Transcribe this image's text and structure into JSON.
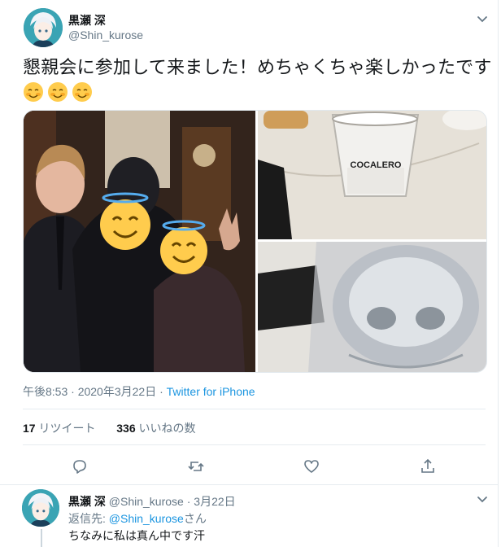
{
  "tweet": {
    "display_name": "黒瀬 深",
    "handle": "@Shin_kurose",
    "text": "懇親会に参加して来ました！めちゃくちゃ楽しかったです",
    "emojis": "☺☺☺",
    "timestamp": "午後8:53 · 2020年3月22日 · ",
    "source": "Twitter for iPhone",
    "retweets_count": "17",
    "retweets_label": "リツイート",
    "likes_count": "336",
    "likes_label": "いいねの数"
  },
  "media": {
    "glass_label": "COCALERO"
  },
  "actions": {
    "reply_icon": "reply-icon",
    "retweet_icon": "retweet-icon",
    "like_icon": "heart-icon",
    "share_icon": "share-icon"
  },
  "reply": {
    "display_name": "黒瀬 深",
    "handle": "@Shin_kurose",
    "date": "3月22日",
    "dot": "·",
    "replying_prefix": "返信先: ",
    "replying_handle": "@Shin_kurose",
    "replying_suffix": "さん",
    "text": "ちなみに私は真ん中です汗"
  },
  "colors": {
    "link": "#1b95e0",
    "secondary_text": "#657786",
    "primary_text": "#14171a"
  }
}
